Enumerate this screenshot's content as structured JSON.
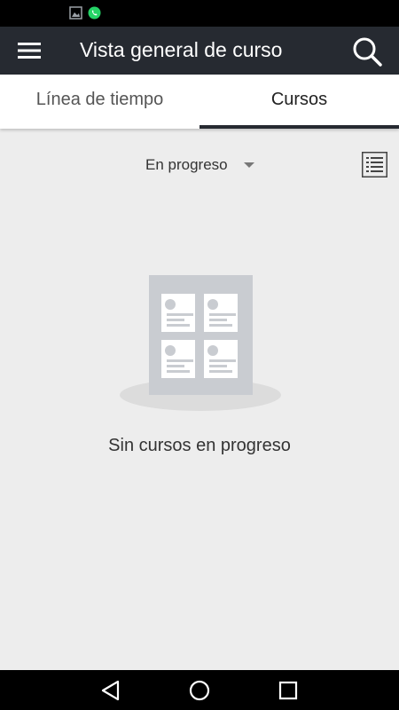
{
  "app_bar": {
    "title": "Vista general de curso"
  },
  "tabs": [
    {
      "label": "Línea de tiempo",
      "active": false
    },
    {
      "label": "Cursos",
      "active": true
    }
  ],
  "filter": {
    "selected": "En progreso"
  },
  "empty_state": {
    "message": "Sin cursos en progreso"
  },
  "icons": {
    "status_left": [
      "image-notification-icon",
      "whatsapp-icon"
    ],
    "menu": "hamburger-menu-icon",
    "search": "search-icon",
    "view_toggle": "list-view-icon",
    "nav": [
      "back-icon",
      "home-icon",
      "recents-icon"
    ]
  },
  "colors": {
    "app_bar": "#262a31",
    "background": "#ededed",
    "illustration": "#c9ccd1",
    "whatsapp": "#25d366"
  }
}
